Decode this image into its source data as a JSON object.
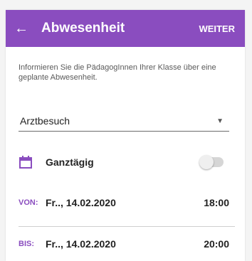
{
  "appbar": {
    "back_icon": "arrow-left-icon",
    "title": "Abwesenheit",
    "action": "WEITER",
    "color": "#8a4dbf"
  },
  "info": {
    "text": "Informieren Sie die PädagogInnen Ihrer Klasse über eine geplante Abwesenheit."
  },
  "reason": {
    "selected": "Arztbesuch"
  },
  "allday": {
    "icon": "calendar-icon",
    "label": "Ganztägig",
    "enabled": false
  },
  "von": {
    "label": "VON:",
    "date": "Fr.., 14.02.2020",
    "time": "18:00"
  },
  "bis": {
    "label": "BIS:",
    "date": "Fr.., 14.02.2020",
    "time": "20:00"
  }
}
